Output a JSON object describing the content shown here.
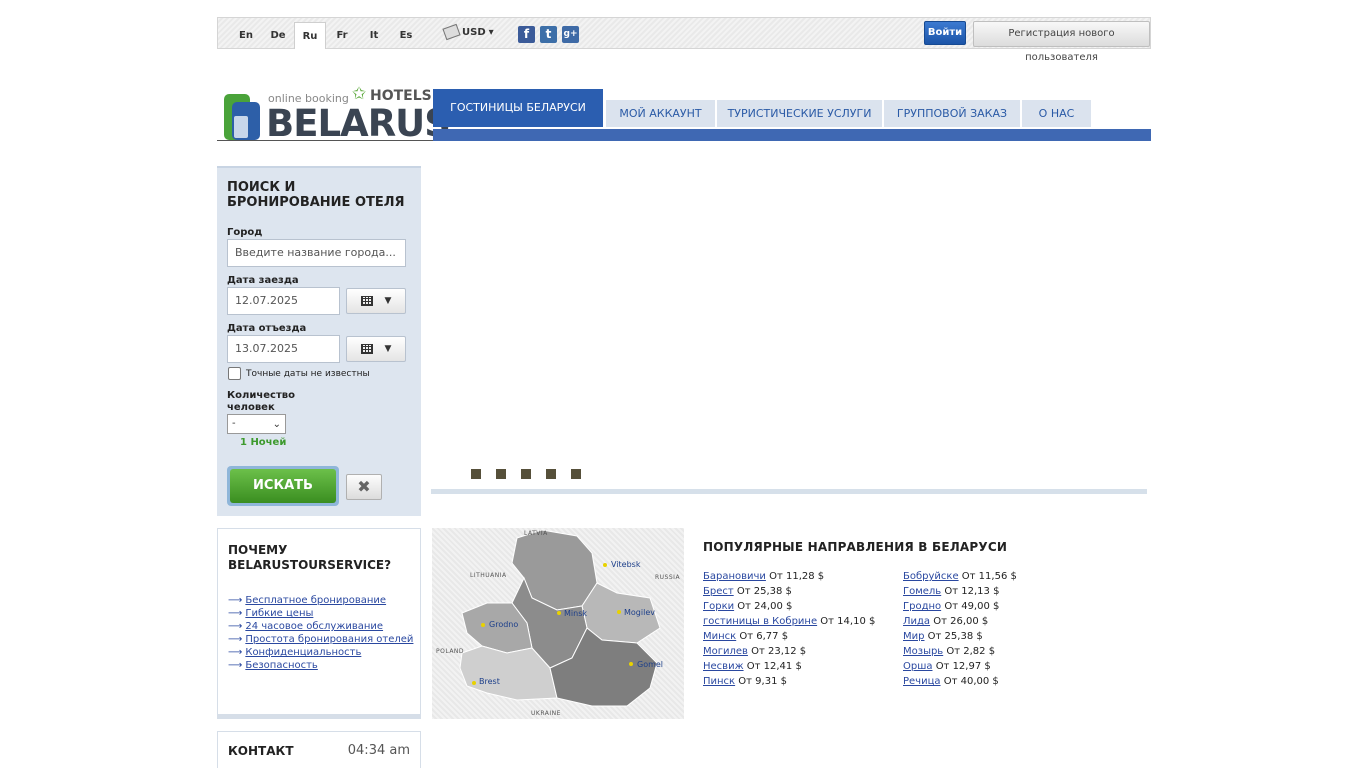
{
  "languages": [
    {
      "label": "En"
    },
    {
      "label": "De"
    },
    {
      "label": "Ru",
      "active": true
    },
    {
      "label": "Fr"
    },
    {
      "label": "It"
    },
    {
      "label": "Es"
    }
  ],
  "currency": {
    "label": "USD"
  },
  "social": {
    "facebook": "f",
    "twitter": "t",
    "google": "g+"
  },
  "auth": {
    "login_label": "Войти",
    "register_label": "Регистрация нового пользователя"
  },
  "logo": {
    "online_booking": "online booking",
    "hotels": "HOTELS",
    "brand": "BELARUS"
  },
  "nav": {
    "tabs": [
      {
        "label": "ГОСТИНИЦЫ БЕЛАРУСИ",
        "active": true
      },
      {
        "label": "МОЙ АККАУНТ"
      },
      {
        "label": "ТУРИСТИЧЕСКИЕ УСЛУГИ"
      },
      {
        "label": "ГРУППОВОЙ ЗАКАЗ"
      },
      {
        "label": "О НАС"
      }
    ]
  },
  "search": {
    "title": "ПОИСК И БРОНИРОВАНИЕ ОТЕЛЯ",
    "city_label": "Город",
    "city_placeholder": "Введите название города...",
    "checkin_label": "Дата заезда",
    "checkin_value": "12.07.2025",
    "checkout_label": "Дата отъезда",
    "checkout_value": "13.07.2025",
    "exact_dates_label": "Точные даты не известны",
    "guests_label_1": "Количество",
    "guests_label_2": "человек",
    "guests_value": "-",
    "nights": "1 Ночей",
    "search_button": "ИСКАТЬ"
  },
  "slider": {
    "dots": 5
  },
  "why": {
    "title": "ПОЧЕМУ BELARUSTOURSERVICE?",
    "items": [
      "Бесплатное бронирование",
      "Гибкие цены",
      "24 часовое обслуживание",
      "Простота бронирования отелей",
      "Конфиденциальность",
      "Безопасность"
    ]
  },
  "contact": {
    "title": "КОНТАКТ",
    "time": "04:34 am"
  },
  "map": {
    "cities": [
      "Vitebsk",
      "Minsk",
      "Mogilev",
      "Grodno",
      "Brest",
      "Gomel"
    ],
    "countries": [
      "LATVIA",
      "LITHUANIA",
      "RUSSIA",
      "POLAND",
      "UKRAINE"
    ]
  },
  "popular": {
    "title": "ПОПУЛЯРНЫЕ НАПРАВЛЕНИЯ В БЕЛАРУСИ",
    "col1": [
      {
        "city": "Барановичи",
        "price": "От 11,28 $"
      },
      {
        "city": "Брест",
        "price": "От 25,38 $"
      },
      {
        "city": "Горки",
        "price": "От 24,00 $"
      },
      {
        "city": "гостиницы в Кобрине",
        "price": "От 14,10 $"
      },
      {
        "city": "Минск",
        "price": "От 6,77 $"
      },
      {
        "city": "Могилев",
        "price": "От 23,12 $"
      },
      {
        "city": "Несвиж",
        "price": "От 12,41 $"
      },
      {
        "city": "Пинск",
        "price": "От 9,31 $"
      }
    ],
    "col2": [
      {
        "city": "Бобруйске",
        "price": "От 11,56 $"
      },
      {
        "city": "Гомель",
        "price": "От 12,13 $"
      },
      {
        "city": "Гродно",
        "price": "От 49,00 $"
      },
      {
        "city": "Лида",
        "price": "От 26,00 $"
      },
      {
        "city": "Мир",
        "price": "От 25,38 $"
      },
      {
        "city": "Мозырь",
        "price": "От 2,82 $"
      },
      {
        "city": "Орша",
        "price": "От 12,97 $"
      },
      {
        "city": "Речица",
        "price": "От 40,00 $"
      }
    ]
  }
}
